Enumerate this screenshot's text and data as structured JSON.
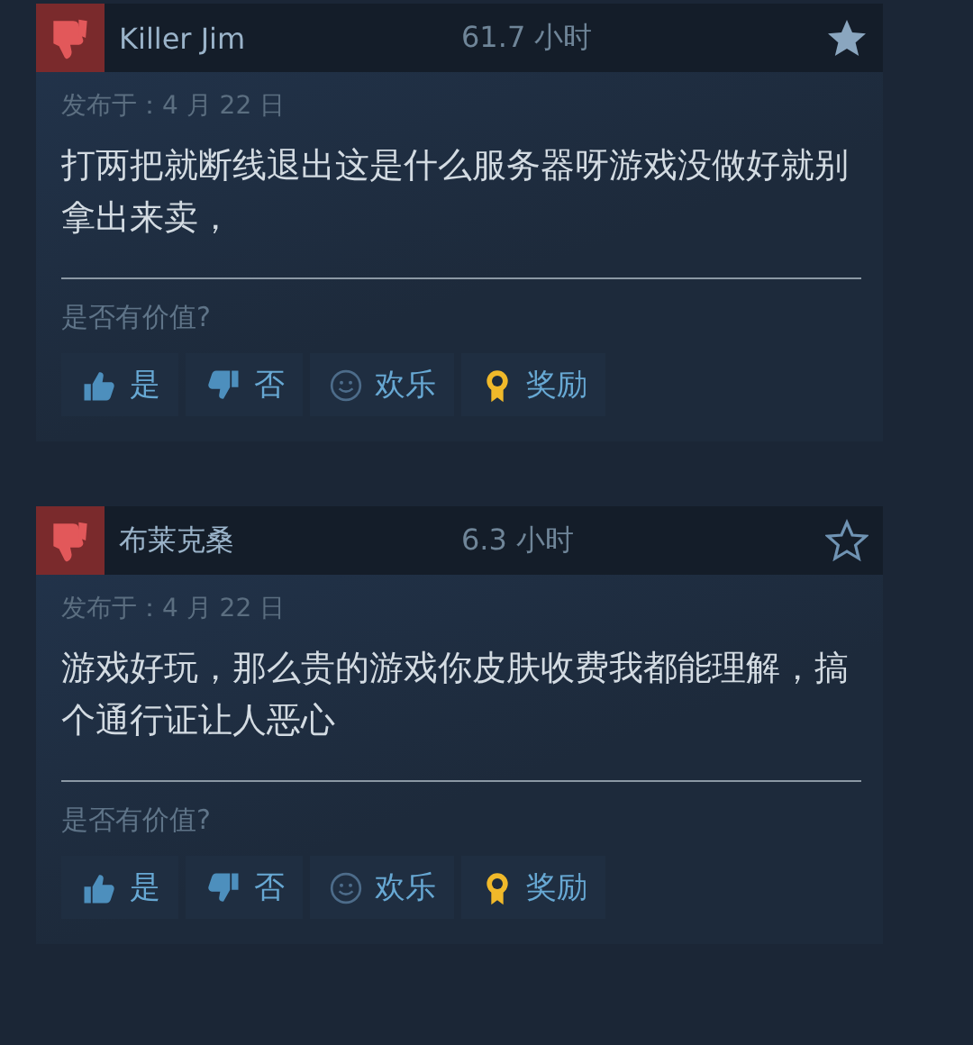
{
  "reviews": [
    {
      "recommended": false,
      "author": "Killer Jim",
      "hours": "61.7 小时",
      "starred": true,
      "posted": "发布于：4 月 22 日",
      "text": "打两把就断线退出这是什么服务器呀游戏没做好就别拿出来卖，",
      "helpful_prompt": "是否有价值?",
      "buttons": [
        {
          "kind": "yes",
          "label": "是"
        },
        {
          "kind": "no",
          "label": "否"
        },
        {
          "kind": "funny",
          "label": "欢乐"
        },
        {
          "kind": "award",
          "label": "奖励"
        }
      ]
    },
    {
      "recommended": false,
      "author": "布莱克桑",
      "hours": "6.3 小时",
      "starred": false,
      "posted": "发布于：4 月 22 日",
      "text": "游戏好玩，那么贵的游戏你皮肤收费我都能理解，搞个通行证让人恶心",
      "helpful_prompt": "是否有价值?",
      "buttons": [
        {
          "kind": "yes",
          "label": "是"
        },
        {
          "kind": "no",
          "label": "否"
        },
        {
          "kind": "funny",
          "label": "欢乐"
        },
        {
          "kind": "award",
          "label": "奖励"
        }
      ]
    }
  ]
}
